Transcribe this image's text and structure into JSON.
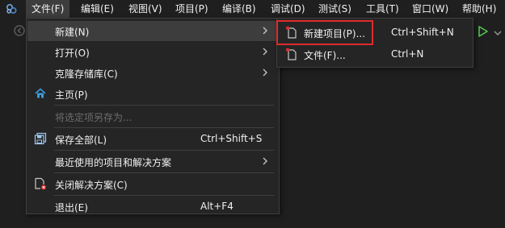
{
  "menubar": {
    "items": [
      {
        "label": "文件(F)"
      },
      {
        "label": "编辑(E)"
      },
      {
        "label": "视图(V)"
      },
      {
        "label": "项目(P)"
      },
      {
        "label": "编译(B)"
      },
      {
        "label": "调试(D)"
      },
      {
        "label": "测试(S)"
      },
      {
        "label": "工具(T)"
      },
      {
        "label": "窗口(W)"
      },
      {
        "label": "帮助(H)"
      }
    ]
  },
  "file_menu": {
    "new": {
      "label": "新建(N)"
    },
    "open": {
      "label": "打开(O)"
    },
    "clone": {
      "label": "克隆存储库(C)"
    },
    "home": {
      "label": "主页(P)"
    },
    "save_selected_as": {
      "label": "将选定项另存为..."
    },
    "save_all": {
      "label": "保存全部(L)",
      "shortcut": "Ctrl+Shift+S"
    },
    "recent": {
      "label": "最近使用的项目和解决方案"
    },
    "close_solution": {
      "label": "关闭解决方案(C)"
    },
    "exit": {
      "label": "退出(E)",
      "shortcut": "Alt+F4"
    }
  },
  "new_submenu": {
    "project": {
      "label": "新建项目(P)...",
      "shortcut": "Ctrl+Shift+N"
    },
    "file": {
      "label": "文件(F)...",
      "shortcut": "Ctrl+N"
    }
  },
  "colors": {
    "accent_red": "#e02b2b",
    "play_green": "#4ec94e",
    "menu_bg": "#252526",
    "hover_bg": "#3d3d3d"
  }
}
